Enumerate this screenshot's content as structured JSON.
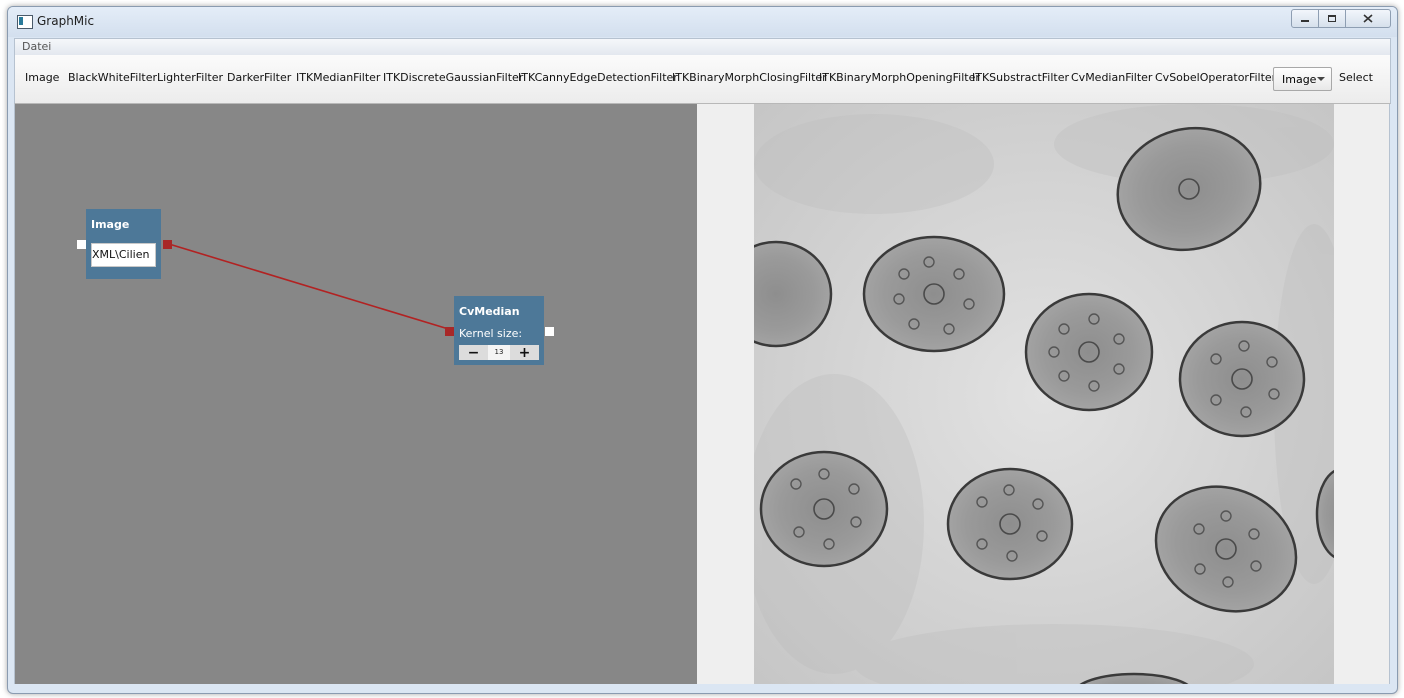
{
  "window": {
    "title": "GraphMic",
    "app_icon": "app-icon",
    "controls": [
      "minimize-icon",
      "maximize-icon",
      "close-icon"
    ]
  },
  "menubar": {
    "items": [
      "Datei"
    ]
  },
  "toolbar": {
    "buttons": [
      "Image",
      "BlackWhiteFilter",
      "LighterFilter",
      "DarkerFilter",
      "ITKMedianFilter",
      "ITKDiscreteGaussianFilter",
      "ITKCannyEdgeDetectionFilter",
      "ITKBinaryMorphClosingFilter",
      "ITKBinaryMorphOpeningFilter",
      "ITKSubstractFilter",
      "CvMedianFilter",
      "CvSobelOperatorFilter"
    ],
    "combo": {
      "selected": "Image",
      "icon": "chevron-down-icon"
    },
    "select_button": "Select"
  },
  "graph": {
    "node_color": "#4d7898",
    "port_out_color": "#a82828",
    "link_color": "#b22222",
    "image_node": {
      "title": "Image",
      "path_value": "XML\\Cilien"
    },
    "cvmedian_node": {
      "title": "CvMedian",
      "kernel_label": "Kernel size:",
      "kernel_value": "13",
      "minus": "−",
      "plus": "+"
    }
  },
  "viewer": {
    "image": "cilia-cross-section-micrograph"
  }
}
